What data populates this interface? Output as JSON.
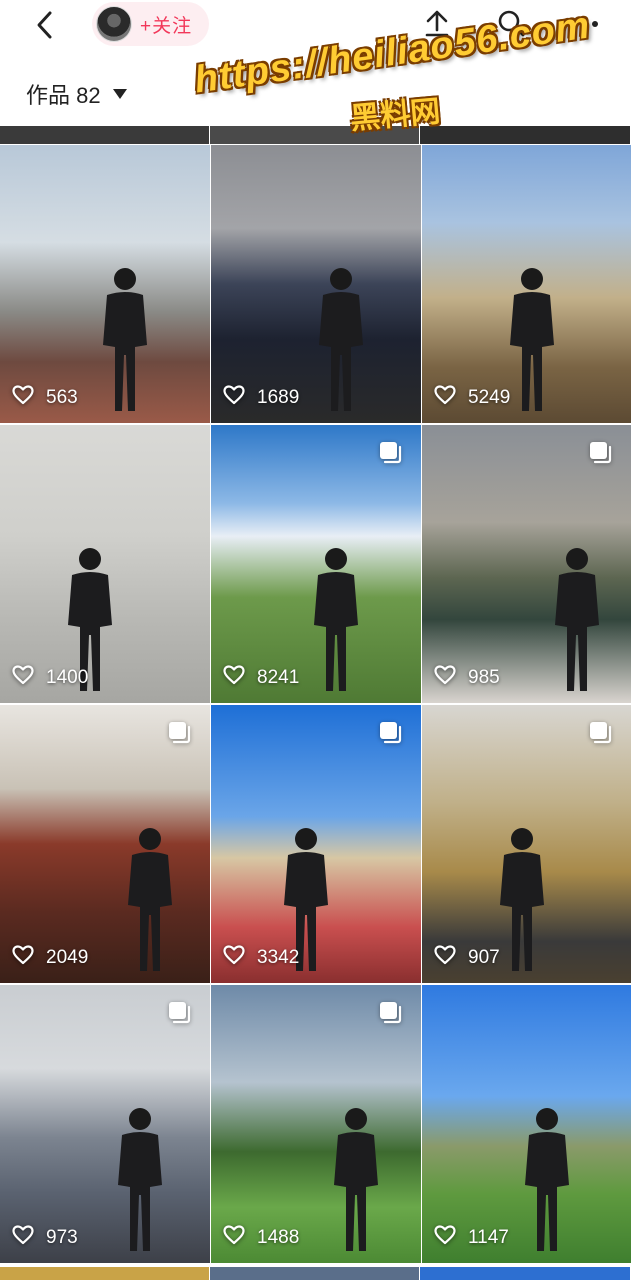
{
  "header": {
    "follow_label": "+关注",
    "works_label": "作品 82"
  },
  "watermark": {
    "line1": "https://heiliao56.com",
    "line2": "黑料网"
  },
  "tiles": [
    {
      "likes": "563",
      "multi": false
    },
    {
      "likes": "1689",
      "multi": false
    },
    {
      "likes": "5249",
      "multi": false
    },
    {
      "likes": "1400",
      "multi": false
    },
    {
      "likes": "8241",
      "multi": true
    },
    {
      "likes": "985",
      "multi": true
    },
    {
      "likes": "2049",
      "multi": true
    },
    {
      "likes": "3342",
      "multi": true
    },
    {
      "likes": "907",
      "multi": true
    },
    {
      "likes": "973",
      "multi": true
    },
    {
      "likes": "1488",
      "multi": true
    },
    {
      "likes": "1147",
      "multi": false
    }
  ],
  "colors": {
    "follow_accent": "#f2385a",
    "follow_bg": "#fdeef1",
    "watermark": "#ffcc33"
  },
  "icons": [
    "back-arrow-icon",
    "share-icon",
    "search-icon",
    "more-icon",
    "dropdown-caret-icon",
    "heart-icon",
    "multi-image-icon"
  ]
}
